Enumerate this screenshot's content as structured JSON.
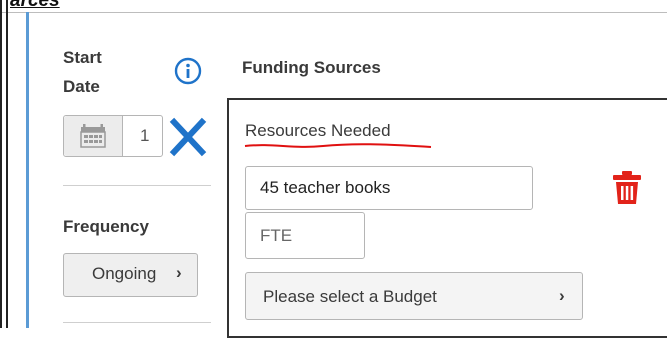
{
  "top_heading": "arces",
  "start_date": {
    "label": "Start Date",
    "value": "1"
  },
  "funding_sources": {
    "label": "Funding Sources"
  },
  "frequency": {
    "label": "Frequency",
    "value": "Ongoing",
    "chevron": "›"
  },
  "resources": {
    "label": "Resources Needed",
    "value": "45 teacher books",
    "fte_placeholder": "FTE",
    "budget_placeholder": "Please select a Budget",
    "chevron": "›"
  },
  "icons": {
    "info": "info-icon",
    "calendar": "calendar-icon",
    "clear": "close-icon",
    "delete": "trash-icon"
  },
  "colors": {
    "accent_blue": "#1f73c9",
    "delete_red": "#e2231a",
    "annotation_red": "#e01010"
  }
}
